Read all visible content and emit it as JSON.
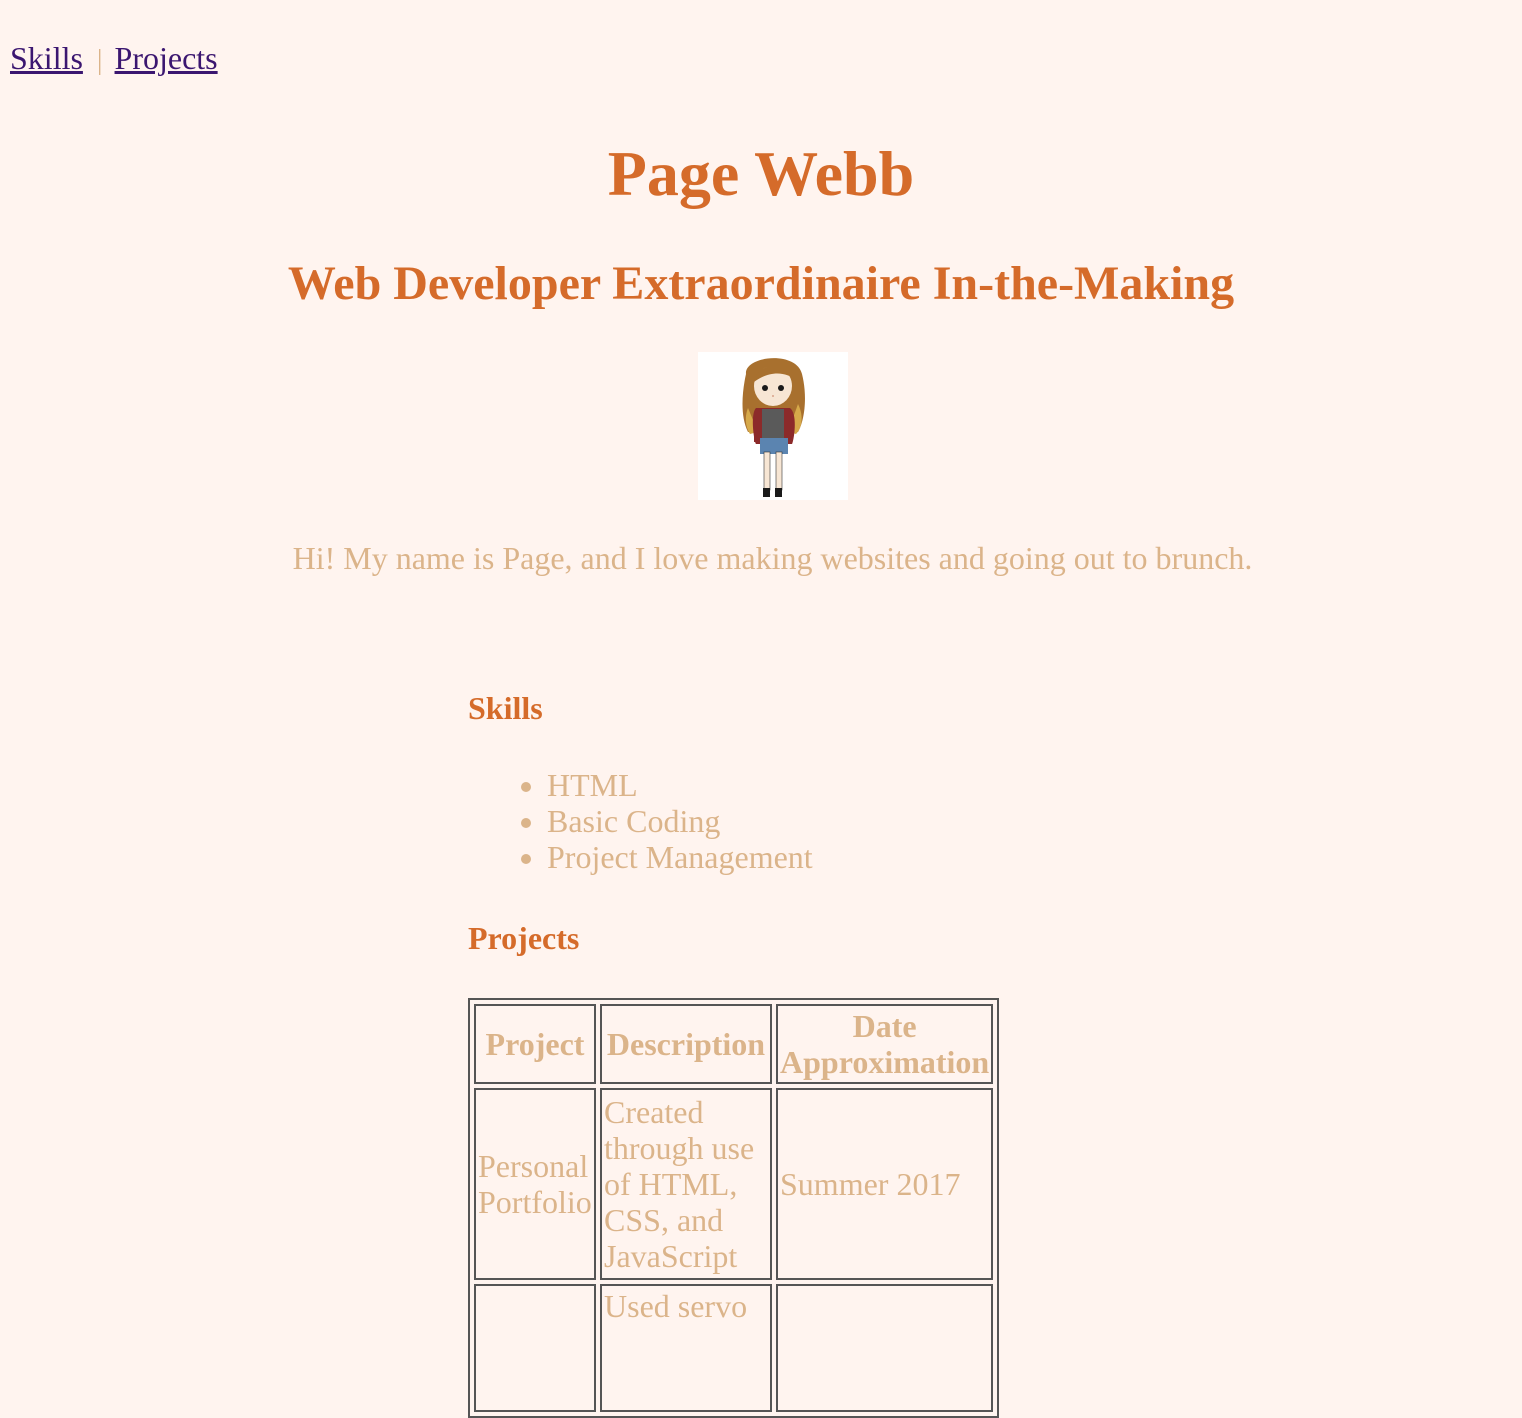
{
  "nav": {
    "skills_link": "Skills",
    "separator": "|",
    "projects_link": "Projects"
  },
  "header": {
    "name": "Page Webb",
    "tagline": "Web Developer Extraordinaire In-the-Making"
  },
  "intro": "Hi! My name is Page, and I love making websites and going out to brunch.",
  "skills": {
    "heading": "Skills",
    "items": [
      "HTML",
      "Basic Coding",
      "Project Management"
    ]
  },
  "projects": {
    "heading": "Projects",
    "columns": [
      "Project",
      "Description",
      "Date Approximation"
    ],
    "rows": [
      {
        "project": "Personal Portfolio",
        "description": "Created through use of HTML, CSS, and JavaScript",
        "date": "Summer 2017"
      },
      {
        "project": "",
        "description": "Used servo",
        "date": ""
      }
    ]
  },
  "colors": {
    "background": "#fff4ef",
    "heading": "#d56b2a",
    "text": "#dbb48a",
    "link": "#3b1670"
  }
}
